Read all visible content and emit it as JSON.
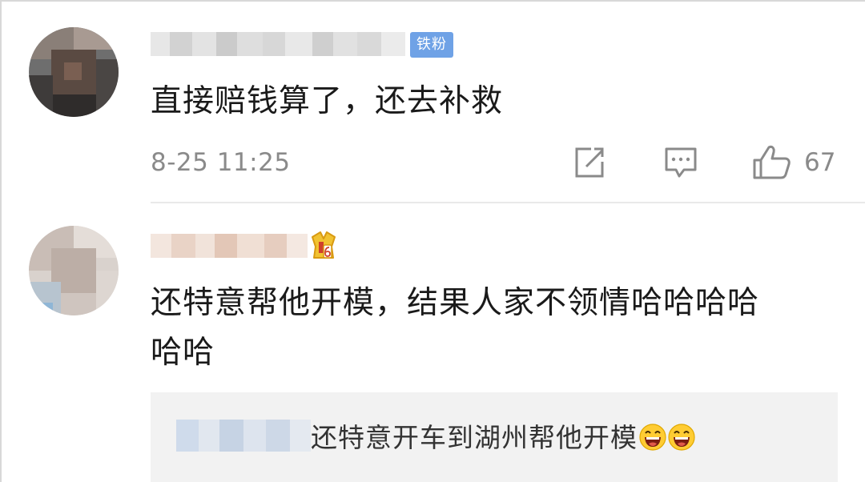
{
  "comments": [
    {
      "badge": "铁粉",
      "text": "直接赔钱算了，还去补救",
      "time": "8-25 11:25",
      "likes": "67",
      "icons": [
        "share-icon",
        "comment-icon",
        "like-icon"
      ]
    },
    {
      "badge_icon": "level-6-badge",
      "text": "还特意帮他开模，结果人家不领情哈哈哈哈\n哈哈",
      "reply": {
        "text": "还特意开车到湖州帮他开模",
        "emoji": [
          "grinning-face-emoji",
          "grinning-face-emoji"
        ]
      }
    }
  ],
  "colors": {
    "badge_bg": "#6fa2e6",
    "text": "#1a1a1a",
    "meta": "#8a8a8a",
    "reply_bg": "#f2f2f2"
  }
}
